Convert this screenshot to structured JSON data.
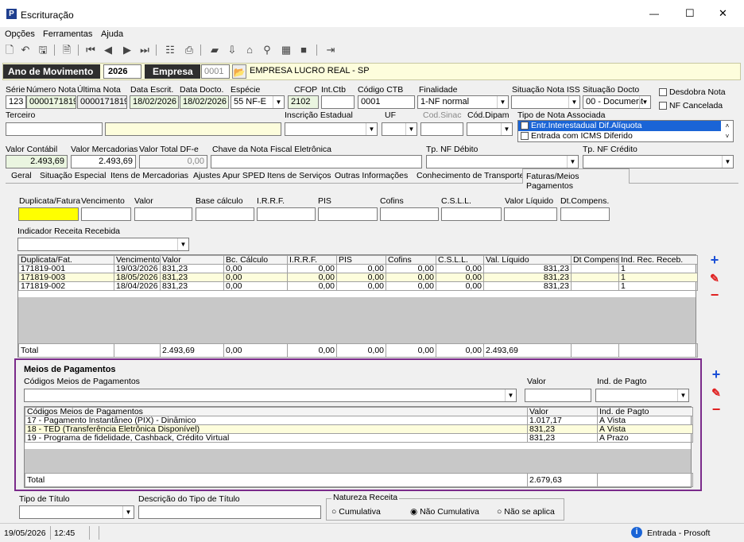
{
  "window": {
    "title": "Escrituração",
    "minimize": "—",
    "maximize": "☐",
    "close": "✕"
  },
  "menu": [
    "Opções",
    "Ferramentas",
    "Ajuda"
  ],
  "header": {
    "ano_label": "Ano de Movimento",
    "ano_value": "2026",
    "empresa_label": "Empresa",
    "empresa_code": "0001",
    "empresa_name": "EMPRESA LUCRO REAL - SP"
  },
  "form": {
    "serie_label": "Série",
    "serie": "123",
    "numero_label": "Número Nota",
    "numero": "0000171819",
    "ultima_label": "Última Nota",
    "ultima": "0000171819",
    "data_escrit_label": "Data Escrit.",
    "data_escrit": "18/02/2026",
    "data_docto_label": "Data Docto.",
    "data_docto": "18/02/2026",
    "especie_label": "Espécie",
    "especie": "55  NF-E",
    "cfop_label": "CFOP",
    "cfop": "2102",
    "intctb_label": "Int.Ctb",
    "intctb": "",
    "codctb_label": "Código CTB",
    "codctb": "0001",
    "finalidade_label": "Finalidade",
    "finalidade": "1-NF normal",
    "situacao_iss_label": "Situação Nota ISS",
    "situacao_iss": "",
    "situacao_docto_label": "Situação Docto",
    "situacao_docto": "00 - Document",
    "desdobra_label": "Desdobra Nota",
    "cancelada_label": "NF Cancelada",
    "terceiro_label": "Terceiro",
    "inscricao_label": "Inscrição Estadual",
    "uf_label": "UF",
    "codsinac_label": "Cod.Sinac",
    "coddipam_label": "Cód.Dipam",
    "tipo_nota_label": "Tipo de Nota Associada",
    "tipo_nota_items": [
      "Entr.Interestadual Dif.Alíquota",
      "Entrada com ICMS Diferido"
    ],
    "valor_contabil_label": "Valor Contábil",
    "valor_contabil": "2.493,69",
    "valor_merc_label": "Valor Mercadorias",
    "valor_merc": "2.493,69",
    "valor_dfe_label": "Valor Total DF-e",
    "valor_dfe": "0,00",
    "chave_label": "Chave da Nota Fiscal Eletrônica",
    "chave": "",
    "tp_debito_label": "Tp. NF Débito",
    "tp_credito_label": "Tp. NF Crédito"
  },
  "tabs": [
    "Geral",
    "Situação Especial",
    "Itens de Mercadorias",
    "Ajustes Apur SPED",
    "Itens de Serviços",
    "Outras Informações",
    "Conhecimento de Transporte",
    "Faturas/Meios Pagamentos"
  ],
  "fatura_fields": [
    "Duplicata/Fatura",
    "Vencimento",
    "Valor",
    "Base cálculo",
    "I.R.R.F.",
    "PIS",
    "Cofins",
    "C.S.L.L.",
    "Valor Líquido",
    "Dt.Compens."
  ],
  "indicador_label": "Indicador Receita Recebida",
  "dup_table": {
    "headers": [
      "Duplicata/Fat.",
      "Vencimento",
      "Valor",
      "Bc. Cálculo",
      "I.R.R.F.",
      "PIS",
      "Cofins",
      "C.S.L.L.",
      "Val. Líquido",
      "Dt Compens.",
      "Ind. Rec. Receb."
    ],
    "rows": [
      [
        "171819-001",
        "19/03/2026",
        "831,23",
        "0,00",
        "0,00",
        "0,00",
        "0,00",
        "0,00",
        "831,23",
        "",
        "1"
      ],
      [
        "171819-003",
        "18/05/2026",
        "831,23",
        "0,00",
        "0,00",
        "0,00",
        "0,00",
        "0,00",
        "831,23",
        "",
        "1"
      ],
      [
        "171819-002",
        "18/04/2026",
        "831,23",
        "0,00",
        "0,00",
        "0,00",
        "0,00",
        "0,00",
        "831,23",
        "",
        "1"
      ]
    ],
    "total": [
      "Total",
      "",
      "2.493,69",
      "0,00",
      "0,00",
      "0,00",
      "0,00",
      "0,00",
      "2.493,69",
      "",
      ""
    ]
  },
  "meios": {
    "title": "Meios de Pagamentos",
    "codigo_label": "Códigos Meios de Pagamentos",
    "valor_label": "Valor",
    "ind_label": "Ind. de Pagto",
    "headers": [
      "Códigos Meios de Pagamentos",
      "Valor",
      "Ind. de Pagto"
    ],
    "rows": [
      [
        "17 - Pagamento Instantâneo (PIX) - Dinâmico",
        "1.017,17",
        "À Vista"
      ],
      [
        "18 - TED (Transferência Eletrônica Disponível)",
        "831,23",
        "À Vista"
      ],
      [
        "19 - Programa de fidelidade, Cashback, Crédito Virtual",
        "831,23",
        "A Prazo"
      ]
    ],
    "total": [
      "Total",
      "2.679,63",
      ""
    ]
  },
  "bottom": {
    "tipo_titulo_label": "Tipo de Título",
    "desc_titulo_label": "Descrição do Tipo de Título",
    "natureza_label": "Natureza Receita",
    "opt1": "Cumulativa",
    "opt2": "Não Cumulativa",
    "opt3": "Não se aplica"
  },
  "status": {
    "date": "19/05/2026",
    "time": "12:45",
    "mode": "Entrada - Prosoft"
  }
}
